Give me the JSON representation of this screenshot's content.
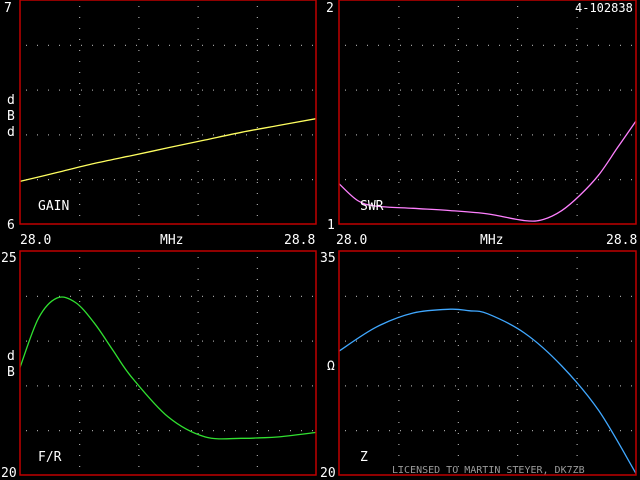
{
  "header": {
    "id_label": "4-102838"
  },
  "footer": {
    "license": "LICENSED TO MARTIN STEYER, DK7ZB"
  },
  "colors": {
    "frame": "#c00000",
    "grid": "#c8c8c8",
    "text": "#ffffff",
    "gain": "#ffff60",
    "swr": "#ff80ff",
    "fr": "#30e030",
    "z": "#40a8ff"
  },
  "chart_data": [
    {
      "type": "line",
      "panel": "gain",
      "label": "GAIN",
      "ylabel": "dBd",
      "xlabel": "MHz",
      "x_tick_labels": [
        "28.0",
        "28.8"
      ],
      "y_tick_labels": [
        "6",
        "7"
      ],
      "xlim": [
        28.0,
        28.8
      ],
      "ylim": [
        6,
        7
      ],
      "grid": true,
      "series": [
        {
          "x": [
            28.0,
            28.1,
            28.2,
            28.3,
            28.4,
            28.5,
            28.6,
            28.7,
            28.8
          ],
          "y": [
            6.19,
            6.23,
            6.27,
            6.305,
            6.34,
            6.375,
            6.41,
            6.44,
            6.47
          ]
        }
      ]
    },
    {
      "type": "line",
      "panel": "swr",
      "label": "SWR",
      "ylabel": "",
      "xlabel": "MHz",
      "x_tick_labels": [
        "28.0",
        "28.8"
      ],
      "y_tick_labels": [
        "1",
        "2"
      ],
      "xlim": [
        28.0,
        28.8
      ],
      "ylim": [
        1,
        2
      ],
      "grid": true,
      "series": [
        {
          "x": [
            28.0,
            28.05,
            28.1,
            28.2,
            28.3,
            28.4,
            28.5,
            28.55,
            28.6,
            28.65,
            28.7,
            28.75,
            28.8
          ],
          "y": [
            1.18,
            1.105,
            1.08,
            1.07,
            1.06,
            1.045,
            1.015,
            1.02,
            1.06,
            1.13,
            1.22,
            1.34,
            1.46
          ]
        }
      ]
    },
    {
      "type": "line",
      "panel": "fr",
      "label": "F/R",
      "ylabel": "dB",
      "xlabel": "",
      "x_tick_labels": [],
      "y_tick_labels": [
        "20",
        "25"
      ],
      "xlim": [
        28.0,
        28.8
      ],
      "ylim": [
        20,
        25
      ],
      "grid": true,
      "series": [
        {
          "x": [
            28.0,
            28.05,
            28.1,
            28.15,
            28.2,
            28.25,
            28.3,
            28.4,
            28.5,
            28.6,
            28.65,
            28.7,
            28.8
          ],
          "y": [
            22.4,
            23.5,
            23.95,
            23.85,
            23.4,
            22.8,
            22.2,
            21.3,
            20.85,
            20.82,
            20.83,
            20.85,
            20.95
          ]
        }
      ]
    },
    {
      "type": "line",
      "panel": "z",
      "label": "Z",
      "ylabel": "Ω",
      "xlabel": "",
      "x_tick_labels": [],
      "y_tick_labels": [
        "20",
        "35"
      ],
      "xlim": [
        28.0,
        28.8
      ],
      "ylim": [
        20,
        35
      ],
      "grid": true,
      "series": [
        {
          "x": [
            28.0,
            28.1,
            28.2,
            28.3,
            28.35,
            28.4,
            28.5,
            28.6,
            28.7,
            28.8
          ],
          "y": [
            28.3,
            29.9,
            30.85,
            31.1,
            31.0,
            30.8,
            29.5,
            27.3,
            24.3,
            20.1
          ]
        }
      ]
    }
  ]
}
